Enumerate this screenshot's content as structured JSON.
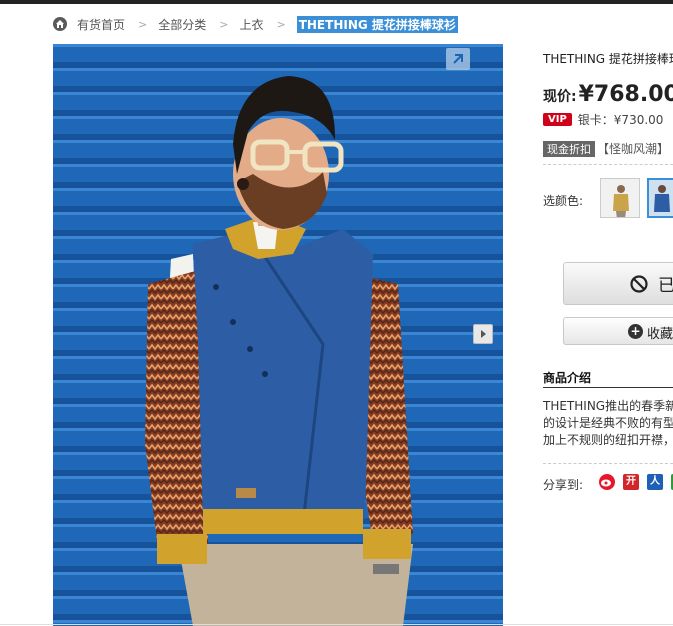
{
  "breadcrumb": {
    "home": "有货首页",
    "sep": ">",
    "all": "全部分类",
    "category": "上衣",
    "current": "THETHING 提花拼接棒球衫"
  },
  "product": {
    "title": "THETHING 提花拼接棒球",
    "price_label": "现价:",
    "price": "¥768.00",
    "vip_badge": "VIP",
    "vip_price": "银卡：¥730.00",
    "promo_badge": "现金折扣",
    "promo_text": "【怪咖风潮】",
    "color_label": "选颜色:"
  },
  "actions": {
    "buy_label": "已",
    "fav_label": "收藏"
  },
  "intro": {
    "title": "商品介绍",
    "lines": [
      "THETHING推出的春季新",
      "的设计是经典不败的有型",
      "加上不规则的纽扣开襟，"
    ]
  },
  "share": {
    "label": "分享到:",
    "kaixin": "开",
    "renren": "人"
  },
  "colors": {
    "photo_bg": "#1d64b4",
    "vest": "#2d5ea5",
    "accent_blue": "#3b8fd7",
    "vip_red": "#d0021b"
  }
}
